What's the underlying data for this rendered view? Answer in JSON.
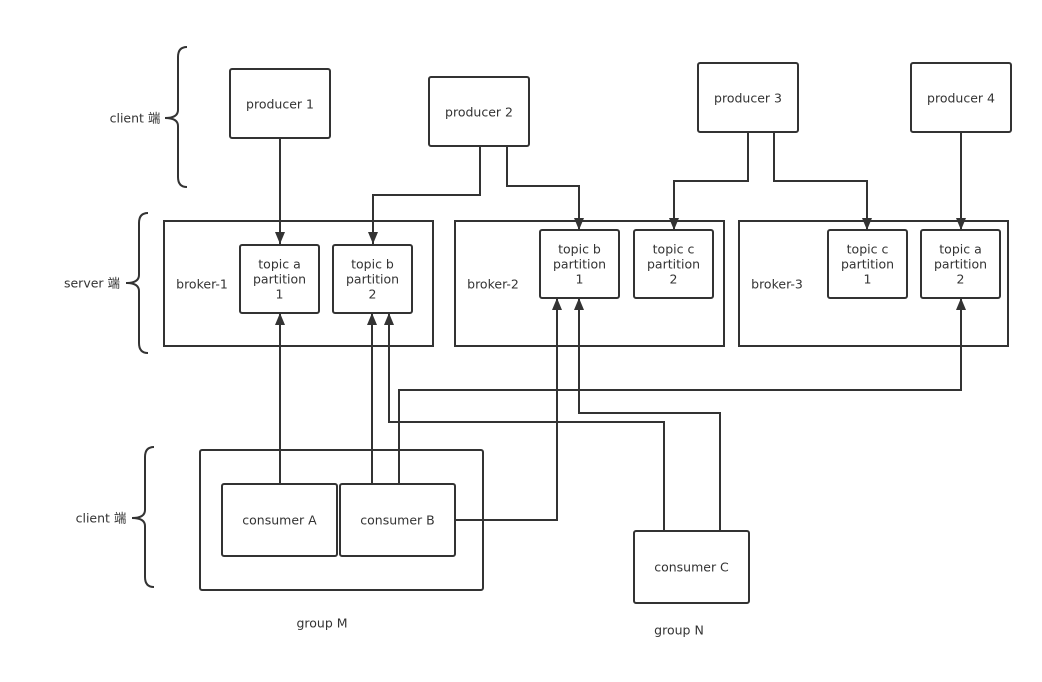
{
  "sides": {
    "client_top": "client 端",
    "server": "server 端",
    "client_bottom": "client 端"
  },
  "producers": [
    "producer 1",
    "producer 2",
    "producer 3",
    "producer 4"
  ],
  "brokers": [
    "broker-1",
    "broker-2",
    "broker-3"
  ],
  "partitions": [
    {
      "topic": "topic a",
      "p": "partition",
      "n": "1"
    },
    {
      "topic": "topic b",
      "p": "partition",
      "n": "2"
    },
    {
      "topic": "topic b",
      "p": "partition",
      "n": "1"
    },
    {
      "topic": "topic c",
      "p": "partition",
      "n": "2"
    },
    {
      "topic": "topic c",
      "p": "partition",
      "n": "1"
    },
    {
      "topic": "topic a",
      "p": "partition",
      "n": "2"
    }
  ],
  "consumers": [
    "consumer A",
    "consumer B",
    "consumer C"
  ],
  "groups": [
    "group M",
    "group N"
  ],
  "line_color": "#333333"
}
